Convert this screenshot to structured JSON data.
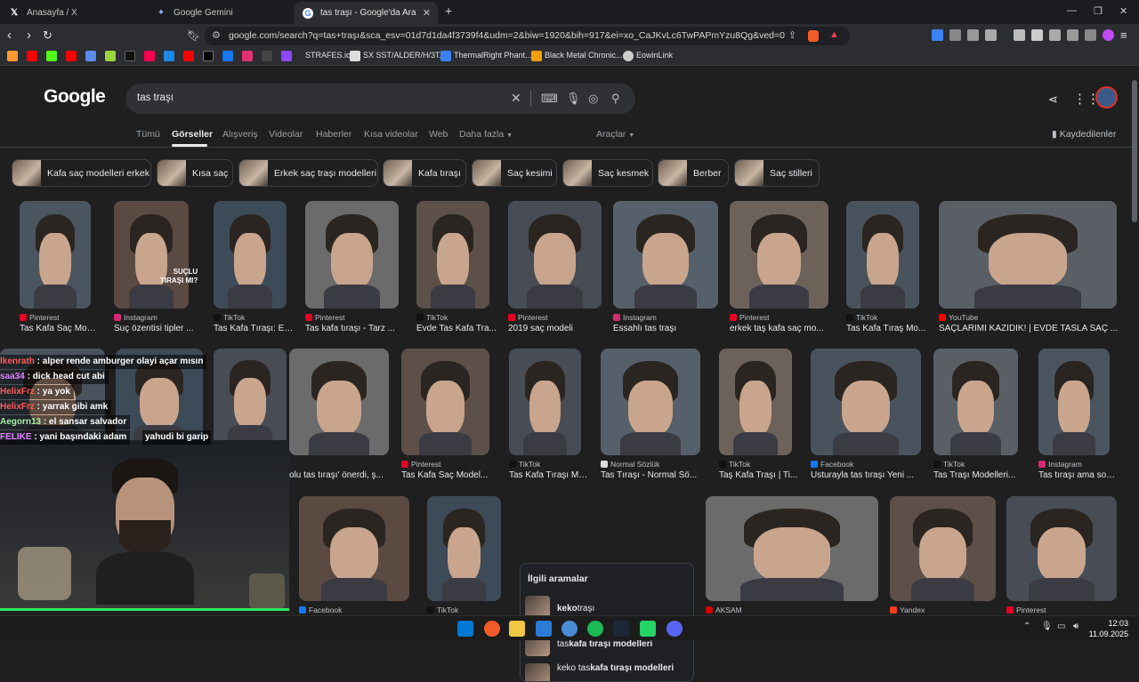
{
  "tabs": [
    {
      "label": "Anasayfa / X",
      "icon": "x-logo-icon"
    },
    {
      "label": "Google Gemini",
      "icon": "gemini-icon"
    },
    {
      "label": "tas traşı - Google'da Ara",
      "icon": "google-icon",
      "active": true
    }
  ],
  "url": "google.com/search?q=tas+traşı&sca_esv=01d7d1da4f3739f4&udm=2&biw=1920&bih=917&ei=xo_CaJKvLc6TwPAPmYzu8Qg&ved=0ahUKEwiSqum...",
  "bookmarks": [
    {
      "label": "STRAFES.io"
    },
    {
      "label": "SX SST/ALDER/H/3T..."
    },
    {
      "label": "ThermalRight Phant..."
    },
    {
      "label": "Black Metal Chronic..."
    },
    {
      "label": "EowinLink"
    }
  ],
  "google": {
    "logo": "Google",
    "query": "tas traşı",
    "nav_tabs": [
      "Tümü",
      "Görseller",
      "Alışveriş",
      "Videolar",
      "Haberler",
      "Kısa videolar",
      "Web",
      "Daha fazla",
      "Araçlar"
    ],
    "saved": "Kaydedilenler",
    "chips": [
      "Kafa saç modelleri erkek",
      "Kısa saç",
      "Erkek saç traşı modelleri",
      "Kafa tıraşı",
      "Saç kesimi",
      "Saç kesmek",
      "Berber",
      "Saç stilleri"
    ]
  },
  "row1": [
    {
      "source": "Pinterest",
      "title": "Tas Kafa Saç Mod..."
    },
    {
      "source": "Instagram",
      "title": "Suç özentisi tipler ..."
    },
    {
      "source": "TikTok",
      "title": "Tas Kafa Tıraşı: En..."
    },
    {
      "source": "Pinterest",
      "title": "Tas kafa tıraşı - Tarz ..."
    },
    {
      "source": "TikTok",
      "title": "Evde Tas Kafa Tra..."
    },
    {
      "source": "Pinterest",
      "title": "2019 saç modeli"
    },
    {
      "source": "Instagram",
      "title": "Essahlı tas traşı"
    },
    {
      "source": "Pinterest",
      "title": "erkek taş kafa saç mo..."
    },
    {
      "source": "TikTok",
      "title": "Tas Kafa Tıraş Mo..."
    },
    {
      "source": "YouTube",
      "title": "SAÇLARIMI KAZIDIK! | EVDE TASLA SAÇ ..."
    }
  ],
  "row1_overlay_text": "SUÇLU\nTIRAŞI MI?",
  "row2": [
    {
      "source": "",
      "title": "olu tas tıraşı' önerdi, ş..."
    },
    {
      "source": "Pinterest",
      "title": "Tas Kafa Saç Model..."
    },
    {
      "source": "TikTok",
      "title": "Tas Kafa Tıraşı Mo..."
    },
    {
      "source": "Normal Sözlük",
      "title": "Tas Tıraşı - Normal Sö..."
    },
    {
      "source": "TikTok",
      "title": "Taş Kafa Traşı | Ti..."
    },
    {
      "source": "Facebook",
      "title": "Usturayla tas tıraşı Yeni ..."
    },
    {
      "source": "TikTok",
      "title": "Tas Traşı Modelleri..."
    },
    {
      "source": "Instagram",
      "title": "Tas tıraşı ama son..."
    }
  ],
  "row3_sources": [
    "Facebook",
    "TikTok",
    "AKSAM",
    "Yandex",
    "Pinterest"
  ],
  "related": {
    "heading": "İlgili aramalar",
    "items": [
      {
        "pre": "keko",
        "post": " traşı"
      },
      {
        "pre": "tas ",
        "post": "kafa tıraşı modelleri"
      },
      {
        "pre": "keko tas ",
        "post": "kafa tıraşı modelleri"
      }
    ]
  },
  "chat": [
    {
      "user": "lkenrath",
      "msg": " : alper rende amburger olayi açar mısın"
    },
    {
      "user": "saa34",
      "msg": " : dick head cut abi"
    },
    {
      "user": "HelixFrz",
      "msg": " : ya yok"
    },
    {
      "user": "HelixFrz",
      "msg": " : yarrak gibi amk"
    },
    {
      "user": "Aegorn13",
      "msg": " : el sansar salvador"
    },
    {
      "user": "FELIKE",
      "msg": " : yani başındaki adam"
    }
  ],
  "chat_extra": "yahudi bi garip",
  "clock": {
    "time": "12:03",
    "date": "11.09.2025"
  },
  "colors": {
    "accent_green": "#2ee65a",
    "tab_active": "#2b2d31",
    "page_bg": "#1f1f1f"
  }
}
